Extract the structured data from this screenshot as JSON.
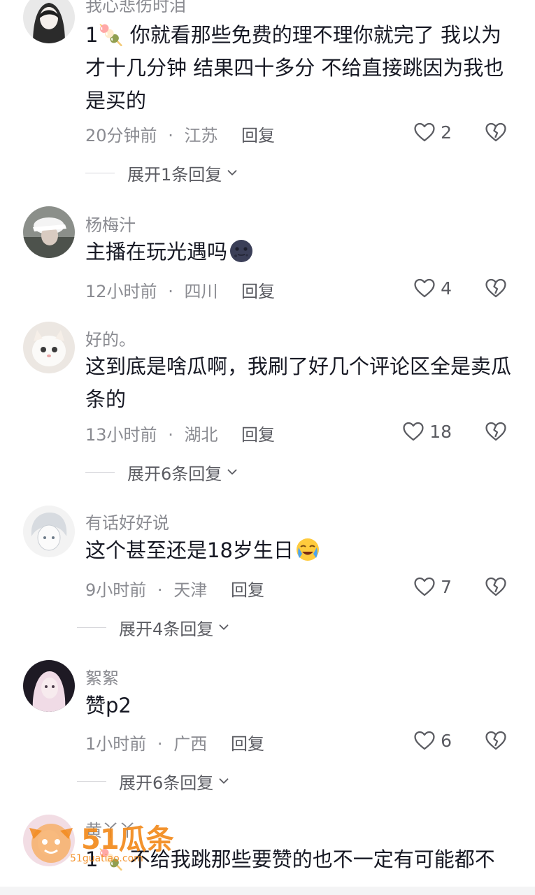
{
  "comments": [
    {
      "username": "我心悲伤时泪",
      "text": "1🍡 你就看那些免费的理不理你就完了 我以为才十几分钟 结果四十多分 不给直接跳因为我也是买的",
      "time": "20分钟前",
      "location": "江苏",
      "reply_label": "回复",
      "likes": "2",
      "expand": "展开1条回复"
    },
    {
      "username": "杨梅汁",
      "text": "主播在玩光遇吗",
      "emoji": "dark-moon-face-emoji",
      "time": "12小时前",
      "location": "四川",
      "reply_label": "回复",
      "likes": "4"
    },
    {
      "username": "好的。",
      "text": "这到底是啥瓜啊，我刷了好几个评论区全是卖瓜条的",
      "time": "13小时前",
      "location": "湖北",
      "reply_label": "回复",
      "likes": "18",
      "expand": "展开6条回复"
    },
    {
      "username": "有话好好说",
      "text": "这个甚至还是18岁生日",
      "emoji": "crying-face-emoji",
      "time": "9小时前",
      "location": "天津",
      "reply_label": "回复",
      "likes": "7",
      "expand": "展开4条回复"
    },
    {
      "username": "絮絮",
      "text": "赞p2",
      "time": "1小时前",
      "location": "广西",
      "reply_label": "回复",
      "likes": "6",
      "expand": "展开6条回复"
    },
    {
      "username": "黄丫丫",
      "text": "1🍡 不给我跳那些要赞的也不一定有可能都不"
    }
  ],
  "separator": "·",
  "watermark": {
    "title": "51瓜条",
    "subtitle": "51guatiao.com"
  },
  "colors": {
    "text": "#161823",
    "secondary": "#8a8b91",
    "action": "#5a5b61",
    "watermark": "#f28a1c"
  }
}
